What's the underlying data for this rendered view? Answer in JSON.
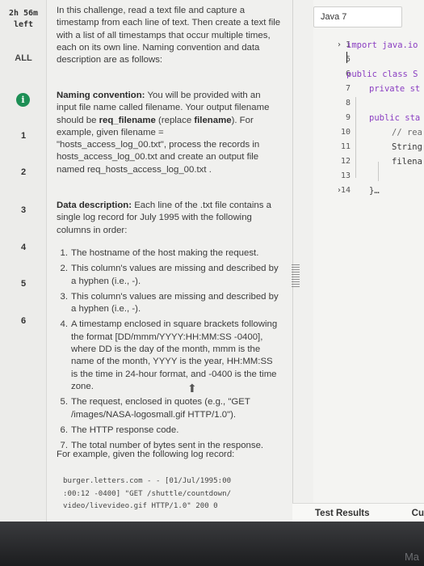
{
  "nav": {
    "timer_line1": "2h 56m",
    "timer_line2": "left",
    "all_label": "ALL",
    "info_icon_glyph": "i",
    "questions": [
      "1",
      "2",
      "3",
      "4",
      "5",
      "6"
    ]
  },
  "problem": {
    "intro": "In this challenge, read a text file and capture a timestamp from each line of text. Then create a text file with a list of all timestamps that occur multiple times, each on its own line. Naming convention and data description are as follows:",
    "naming_heading": "Naming convention:",
    "naming_body_1": " You will be provided with an input file name called filename. Your output filename should be ",
    "naming_req": "req_filename",
    "naming_body_2": " (replace ",
    "naming_filename": "filename",
    "naming_body_3": "). For example, given filename = \"hosts_access_log_00.txt\", process the records in hosts_access_log_00.txt and create an output file named req_hosts_access_log_00.txt .",
    "data_heading": "Data description:",
    "data_body": " Each line of the .txt file contains a single log record for July 1995 with the following columns in order:",
    "columns": [
      {
        "num": "1.",
        "text": "The hostname of the host making the request."
      },
      {
        "num": "2.",
        "text": "This column's values are missing and described by a hyphen (i.e., -)."
      },
      {
        "num": "3.",
        "text": "This column's values are missing and described by a hyphen (i.e., -)."
      },
      {
        "num": "4.",
        "text": "A timestamp enclosed in square brackets following the format [DD/mmm/YYYY:HH:MM:SS -0400], where DD is the day of the month, mmm is the name of the month, YYYY is the year, HH:MM:SS is the time in 24-hour format, and -0400 is the time zone."
      },
      {
        "num": "5.",
        "text": "The request, enclosed in quotes (e.g., \"GET /images/NASA-logosmall.gif HTTP/1.0\")."
      },
      {
        "num": "6.",
        "text": "The HTTP response code."
      },
      {
        "num": "7.",
        "text": "The total number of bytes sent in the response."
      }
    ],
    "example_intro": "For example, given the following log record:",
    "example_line1": "burger.letters.com - - [01/Jul/1995:00",
    "example_line2": ":00:12 -0400] \"GET /shuttle/countdown/",
    "example_line3": "video/livevideo.gif HTTP/1.0\" 200 0"
  },
  "editor": {
    "language": "Java 7",
    "line_numbers": [
      "1",
      "5",
      "6",
      "7",
      "8",
      "9",
      "10",
      "11",
      "12",
      "13",
      "14"
    ],
    "code_lines": {
      "l1": "import java.io",
      "l6": "public class S",
      "l7": "private st",
      "l9": "public sta",
      "l10": "// rea",
      "l11": "String",
      "l12": "filena",
      "l14": "}…"
    }
  },
  "results": {
    "test_results": "Test Results",
    "custom": "Cu"
  },
  "bezel": {
    "brand": "Ma"
  }
}
